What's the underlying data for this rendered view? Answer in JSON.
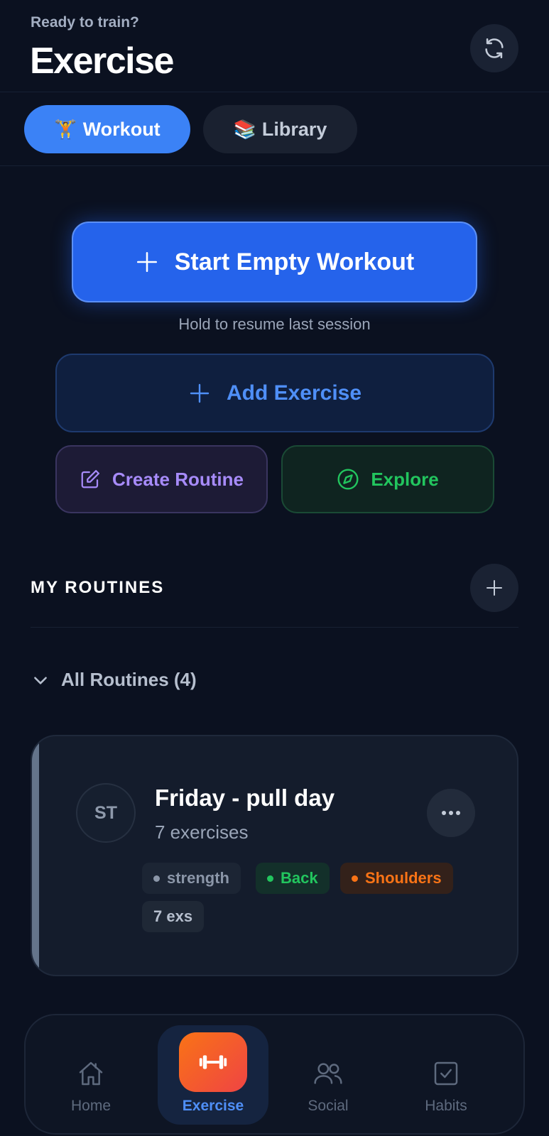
{
  "header": {
    "greeting": "Ready to train?",
    "title": "Exercise",
    "sync_icon": "sync-icon"
  },
  "tabs": [
    {
      "emoji": "🏋️",
      "label": "Workout",
      "active": true
    },
    {
      "emoji": "📚",
      "label": "Library",
      "active": false
    }
  ],
  "actions": {
    "start_label": "Start Empty Workout",
    "start_hint": "Hold to resume last session",
    "add_exercise_label": "Add Exercise",
    "create_routine_label": "Create Routine",
    "explore_label": "Explore"
  },
  "routines": {
    "section_title": "MY ROUTINES",
    "group_label": "All Routines (4)",
    "items": [
      {
        "initials": "ST",
        "name": "Friday - pull day",
        "exercise_count": "7 exercises",
        "tags": [
          {
            "label": "strength",
            "color": "#8b96a8"
          },
          {
            "label": "Back",
            "color": "#22c55e"
          },
          {
            "label": "Shoulders",
            "color": "#f97316"
          }
        ],
        "badge": "7 exs"
      }
    ]
  },
  "nav": [
    {
      "label": "Home",
      "icon": "home-icon",
      "active": false
    },
    {
      "label": "Exercise",
      "icon": "dumbbell-icon",
      "active": true
    },
    {
      "label": "Social",
      "icon": "users-icon",
      "active": false
    },
    {
      "label": "Habits",
      "icon": "checkbox-icon",
      "active": false
    }
  ],
  "colors": {
    "background": "#0b1120",
    "primary": "#2563eb",
    "accent_blue": "#3b82f6",
    "purple": "#a78bfa",
    "green": "#22c55e",
    "orange": "#f97316"
  }
}
